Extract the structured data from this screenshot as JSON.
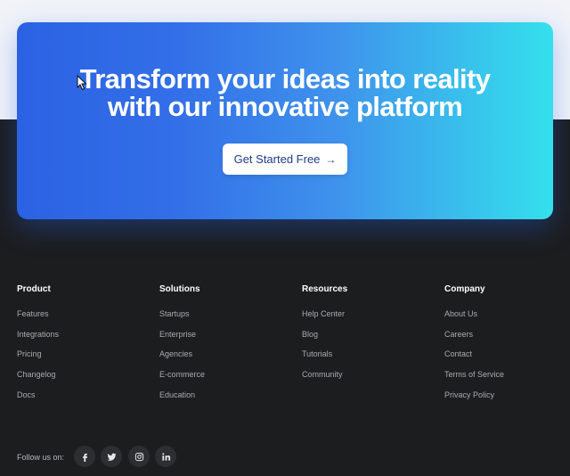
{
  "hero": {
    "title_line1": "Transform your ideas into reality",
    "title_line2": "with our innovative platform",
    "cta_label": "Get Started Free",
    "cta_arrow": "→"
  },
  "footer": {
    "columns": [
      {
        "title": "Product",
        "links": [
          "Features",
          "Integrations",
          "Pricing",
          "Changelog",
          "Docs"
        ]
      },
      {
        "title": "Solutions",
        "links": [
          "Startups",
          "Enterprise",
          "Agencies",
          "E-commerce",
          "Education"
        ]
      },
      {
        "title": "Resources",
        "links": [
          "Help Center",
          "Blog",
          "Tutorials",
          "Community"
        ]
      },
      {
        "title": "Company",
        "links": [
          "About Us",
          "Careers",
          "Contact",
          "Terms of Service",
          "Privacy Policy"
        ]
      }
    ],
    "follow_label": "Follow us on:",
    "social_icons": [
      "facebook-icon",
      "twitter-icon",
      "instagram-icon",
      "linkedin-icon"
    ]
  },
  "colors": {
    "gradient_start": "#2b62e3",
    "gradient_end": "#34e0ec",
    "footer_bg": "#1c1d1f",
    "cta_text": "#1f3b8a"
  }
}
